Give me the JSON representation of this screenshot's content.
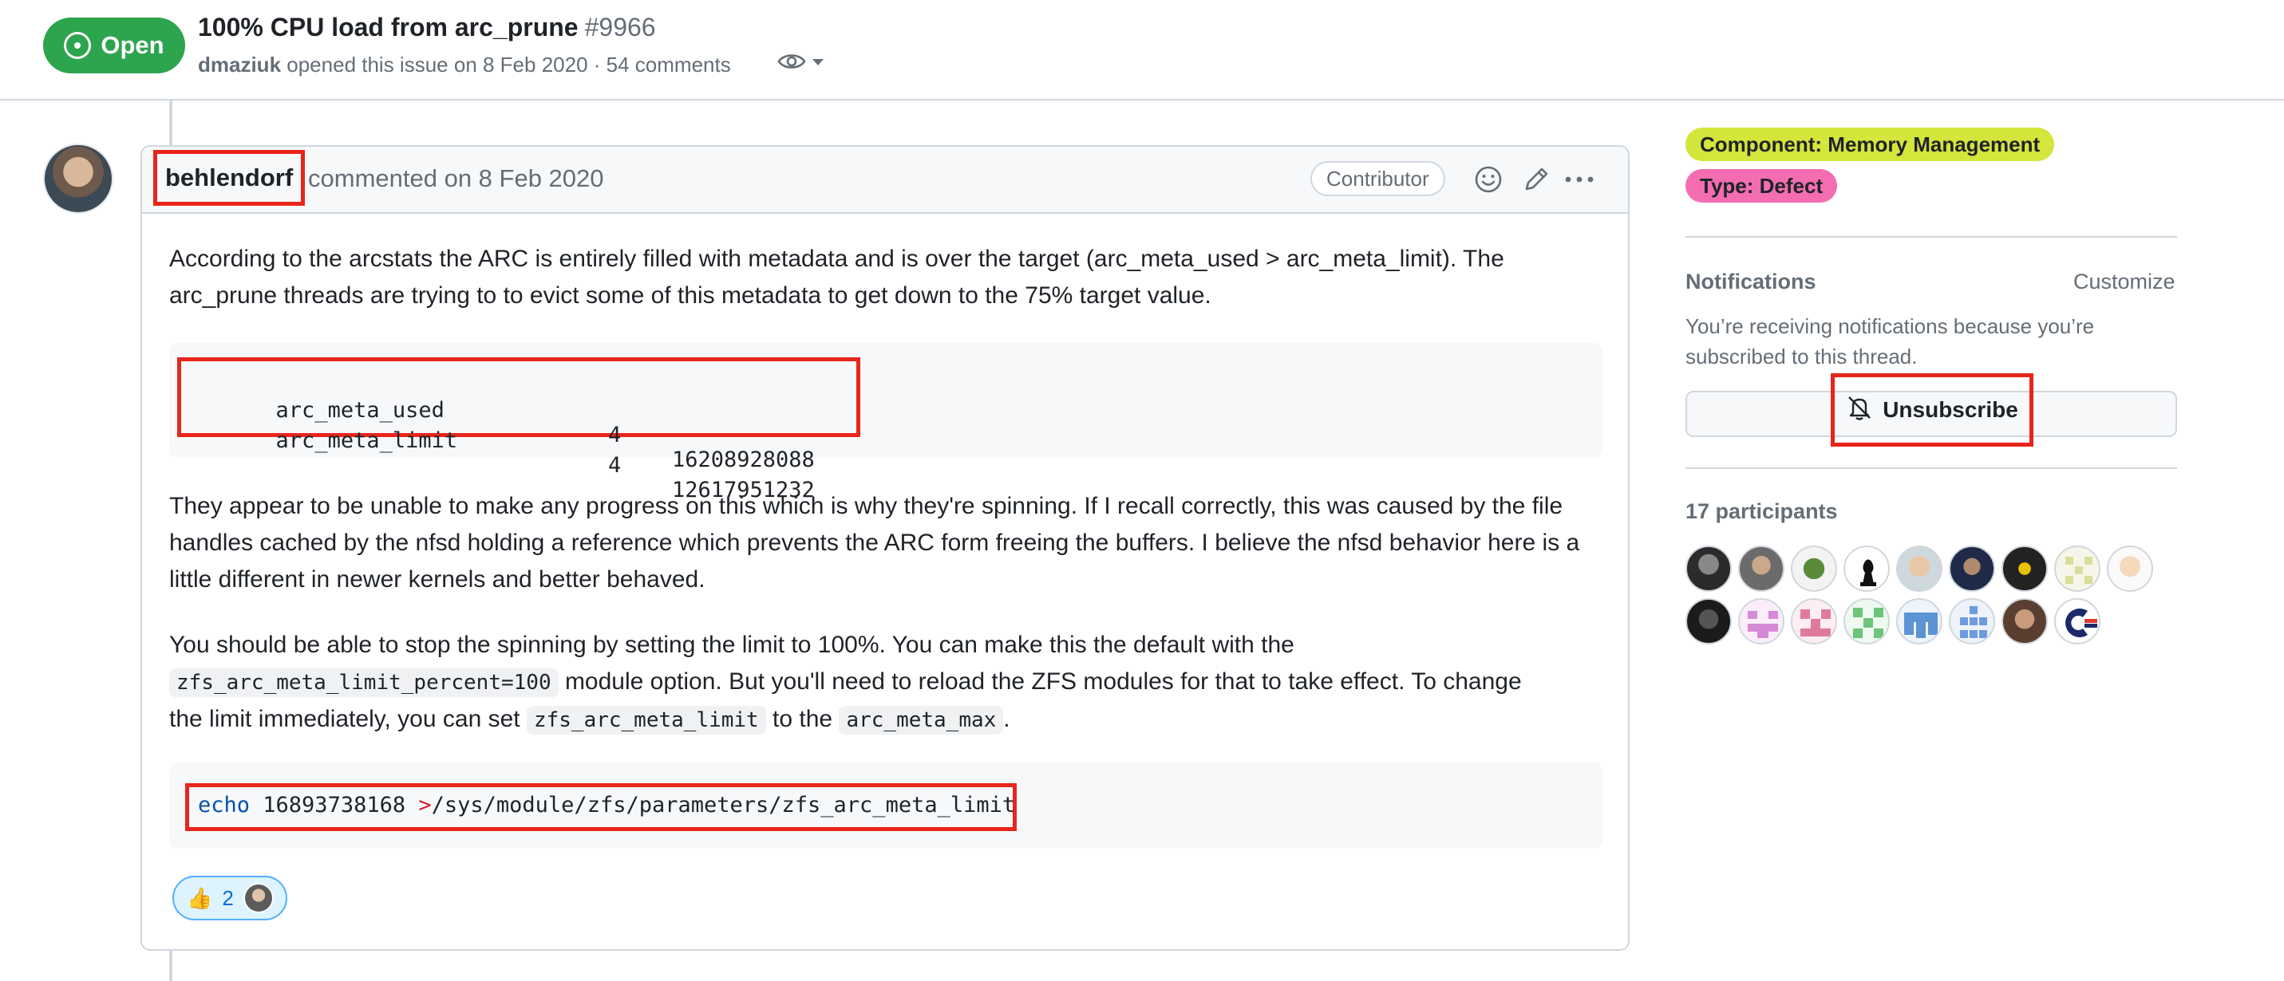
{
  "issue": {
    "state": "Open",
    "title": "100% CPU load from arc_prune",
    "number": "#9966",
    "author": "dmaziuk",
    "meta_text": "opened this issue on 8 Feb 2020 · 54 comments"
  },
  "comment": {
    "author": "behlendorf",
    "date_text": "commented on 8 Feb 2020",
    "role": "Contributor",
    "paragraph1": "According to the arcstats the ARC is entirely filled with metadata and is over the target (arc_meta_used > arc_meta_limit). The arc_prune threads are trying to to evict some of this metadata to get down to the 75% target value.",
    "code_rows": [
      {
        "name": "arc_meta_used",
        "type": "4",
        "value": "16208928088"
      },
      {
        "name": "arc_meta_limit",
        "type": "4",
        "value": "12617951232"
      }
    ],
    "paragraph2": "They appear to be unable to make any progress on this which is why they're spinning. If I recall correctly, this was caused by the file handles cached by the nfsd holding a reference which prevents the ARC form freeing the buffers. I believe the nfsd behavior here is a little different in newer kernels and better behaved.",
    "p3": {
      "line1": "You should be able to stop the spinning by setting the limit to 100%. You can make this the default with the",
      "code_a": "zfs_arc_meta_limit_percent=100",
      "text_a": " module option. But you'll need to reload the ZFS modules for that to take effect. To change",
      "text_b": "the limit immediately, you can set ",
      "code_b": "zfs_arc_meta_limit",
      "text_c": " to the ",
      "code_c": "arc_meta_max",
      "text_d": "."
    },
    "command": {
      "keyword": "echo",
      "number": " 16893738168 ",
      "operator": ">",
      "path": "/sys/module/zfs/parameters/zfs_arc_meta_limit"
    },
    "reaction": {
      "emoji": "👍",
      "count": "2"
    }
  },
  "sidebar": {
    "labels": [
      {
        "text": "Component: Memory Management",
        "bg": "#d4e53b",
        "fg": "#1f2328"
      },
      {
        "text": "Type: Defect",
        "bg": "#f46db1",
        "fg": "#1f2328"
      }
    ],
    "notifications": {
      "heading": "Notifications",
      "customize": "Customize",
      "desc_line1": "You’re receiving notifications because you’re",
      "desc_line2": "subscribed to this thread.",
      "button": "Unsubscribe"
    },
    "participants_heading": "17 participants"
  },
  "colors": {
    "open_green": "#2da44e",
    "annotation_red": "#e8251b",
    "keyword_blue": "#0550ae",
    "operator_red": "#cf222e"
  }
}
